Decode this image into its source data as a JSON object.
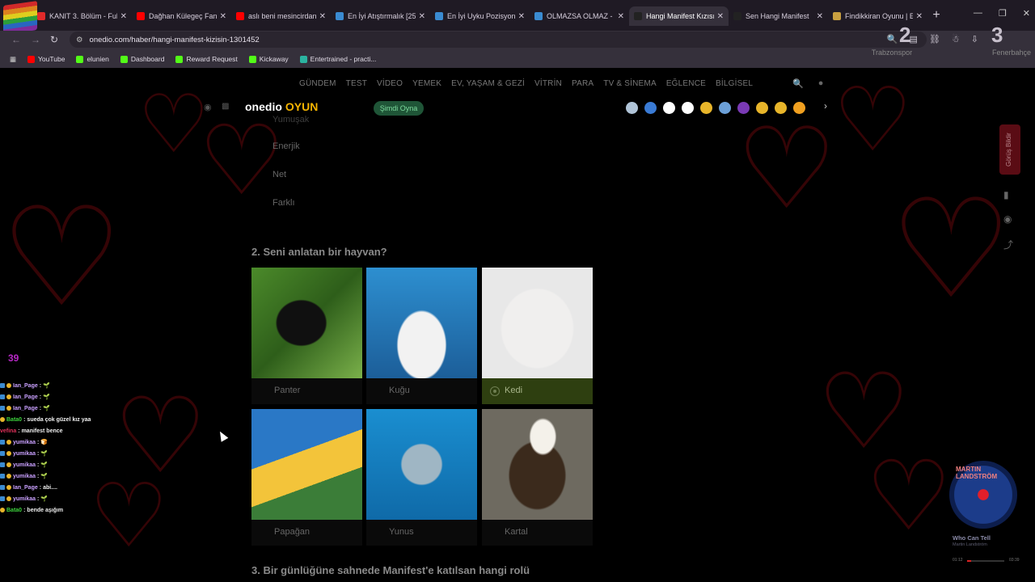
{
  "tabs": [
    {
      "title": "KANIT 3. Bölüm - Full",
      "color": "#e02a2a",
      "active": false
    },
    {
      "title": "Dağhan Külegeç Fan",
      "color": "#ff0000",
      "active": false
    },
    {
      "title": "aslı beni mesincirdan",
      "color": "#ff0000",
      "active": false
    },
    {
      "title": "En İyi Atıştırmalık [25",
      "color": "#3a8bd1",
      "active": false
    },
    {
      "title": "En İyi Uyku Pozisyonu",
      "color": "#3a8bd1",
      "active": false
    },
    {
      "title": "OLMAZSA OLMAZ -",
      "color": "#3a8bd1",
      "active": false
    },
    {
      "title": "Hangi Manifest Kızısı",
      "color": "#222",
      "active": true
    },
    {
      "title": "Sen Hangi Manifest",
      "color": "#222",
      "active": false
    },
    {
      "title": "Findikkiran Oyunu | E",
      "color": "#c9a040",
      "active": false
    }
  ],
  "address": "onedio.com/haber/hangi-manifest-kizisin-1301452",
  "bookmarks": [
    "YouTube",
    "elunien",
    "Dashboard",
    "Reward Request",
    "Kickaway",
    "Entertrained - practi..."
  ],
  "overlay": {
    "score_left": "2",
    "team_left": "Trabzonspor",
    "score_right": "3",
    "team_right": "Fenerbahçe"
  },
  "sitenav": [
    "GÜNDEM",
    "TEST",
    "VİDEO",
    "YEMEK",
    "EV, YAŞAM & GEZİ",
    "VİTRİN",
    "PARA",
    "TV & SİNEMA",
    "EĞLENCE",
    "BİLGİSEL"
  ],
  "oyun": {
    "logo": "onedio",
    "logo_accent": "OYUN",
    "cta": "Şimdi Oyna"
  },
  "q1_options": [
    "Yumuşak",
    "Enerjik",
    "Net",
    "Farklı"
  ],
  "q2": {
    "title": "2. Seni anlatan bir hayvan?",
    "options": [
      "Panter",
      "Kuğu",
      "Kedi",
      "Papağan",
      "Yunus",
      "Kartal"
    ],
    "selected": "Kedi"
  },
  "q3_title": "3. Bir günlüğüne sahnede Manifest'e katılsan hangi rolü",
  "side_feedback": "Görüş Bildir",
  "viewer_count": "39",
  "chat": [
    {
      "user": "Ian_Page",
      "color": "#c9a0ff",
      "msg": "🌱",
      "badge": "b1"
    },
    {
      "user": "Ian_Page",
      "color": "#c9a0ff",
      "msg": "🌱",
      "badge": "b1"
    },
    {
      "user": "Ian_Page",
      "color": "#c9a0ff",
      "msg": "🌱",
      "badge": "b1"
    },
    {
      "user": "Bata0",
      "color": "#3dd43d",
      "msg": "sueda çok güzel kız yaa",
      "badge": "b2"
    },
    {
      "user": "vefina",
      "color": "#e0305a",
      "msg": "manifest bence",
      "badge": ""
    },
    {
      "user": "yumikaa",
      "color": "#c9a0ff",
      "msg": "🍞",
      "badge": "b1"
    },
    {
      "user": "yumikaa",
      "color": "#c9a0ff",
      "msg": "🌱",
      "badge": "b1"
    },
    {
      "user": "yumikaa",
      "color": "#c9a0ff",
      "msg": "🌱",
      "badge": "b1"
    },
    {
      "user": "yumikaa",
      "color": "#c9a0ff",
      "msg": "🌱",
      "badge": "b1"
    },
    {
      "user": "Ian_Page",
      "color": "#c9a0ff",
      "msg": "abi....",
      "badge": "b1"
    },
    {
      "user": "yumikaa",
      "color": "#c9a0ff",
      "msg": "🌱",
      "badge": "b1"
    },
    {
      "user": "Bata0",
      "color": "#3dd43d",
      "msg": "bende aşığım",
      "badge": "b2"
    }
  ],
  "music": {
    "song": "Who Can Tell",
    "artist": "Martin Landström",
    "elapsed": "01:12",
    "total": "03:39",
    "progress": 0.1,
    "disc_text": "MARTIN LANDSTRÖM"
  }
}
